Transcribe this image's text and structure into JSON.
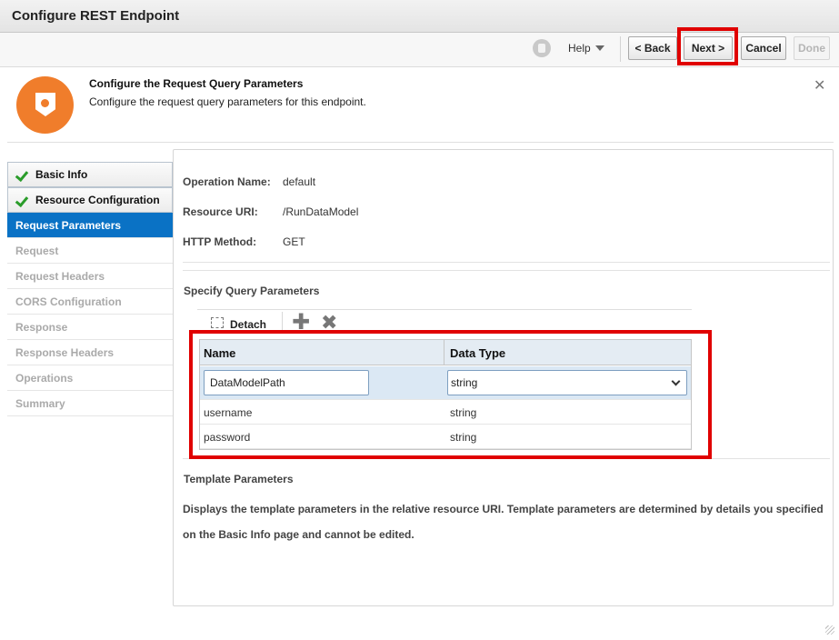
{
  "window": {
    "title": "Configure REST Endpoint"
  },
  "toolbar": {
    "help_label": "Help",
    "back_label": "< Back",
    "next_label": "Next >",
    "cancel_label": "Cancel",
    "done_label": "Done"
  },
  "header": {
    "title": "Configure the Request Query Parameters",
    "subtitle": "Configure the request query parameters for this endpoint.",
    "close_glyph": "✕"
  },
  "nav": {
    "items": [
      {
        "label": "Basic Info",
        "state": "done"
      },
      {
        "label": "Resource Configuration",
        "state": "done"
      },
      {
        "label": "Request Parameters",
        "state": "active"
      },
      {
        "label": "Request",
        "state": "disabled"
      },
      {
        "label": "Request Headers",
        "state": "disabled"
      },
      {
        "label": "CORS Configuration",
        "state": "disabled"
      },
      {
        "label": "Response",
        "state": "disabled"
      },
      {
        "label": "Response Headers",
        "state": "disabled"
      },
      {
        "label": "Operations",
        "state": "disabled"
      },
      {
        "label": "Summary",
        "state": "disabled"
      }
    ]
  },
  "operation": {
    "name_label": "Operation Name:",
    "name_value": "default",
    "uri_label": "Resource URI:",
    "uri_value": "/RunDataModel",
    "method_label": "HTTP Method:",
    "method_value": "GET"
  },
  "query_params": {
    "section_title": "Specify Query Parameters",
    "detach_label": "Detach",
    "add_glyph": "✚",
    "delete_glyph": "✖",
    "columns": [
      "Name",
      "Data Type"
    ],
    "rows": [
      {
        "name": "DataModelPath",
        "type": "string"
      },
      {
        "name": "username",
        "type": "string"
      },
      {
        "name": "password",
        "type": "string"
      }
    ]
  },
  "template_params": {
    "section_title": "Template Parameters",
    "description_line1": "Displays the template parameters in the relative resource URI. Template parameters are determined by details you specified",
    "description_line2": "on the Basic Info page and cannot be edited."
  },
  "colors": {
    "accent": "#0a72c5",
    "highlight": "#e00000",
    "header_icon": "#f07d2b",
    "check": "#2a9c2a"
  }
}
